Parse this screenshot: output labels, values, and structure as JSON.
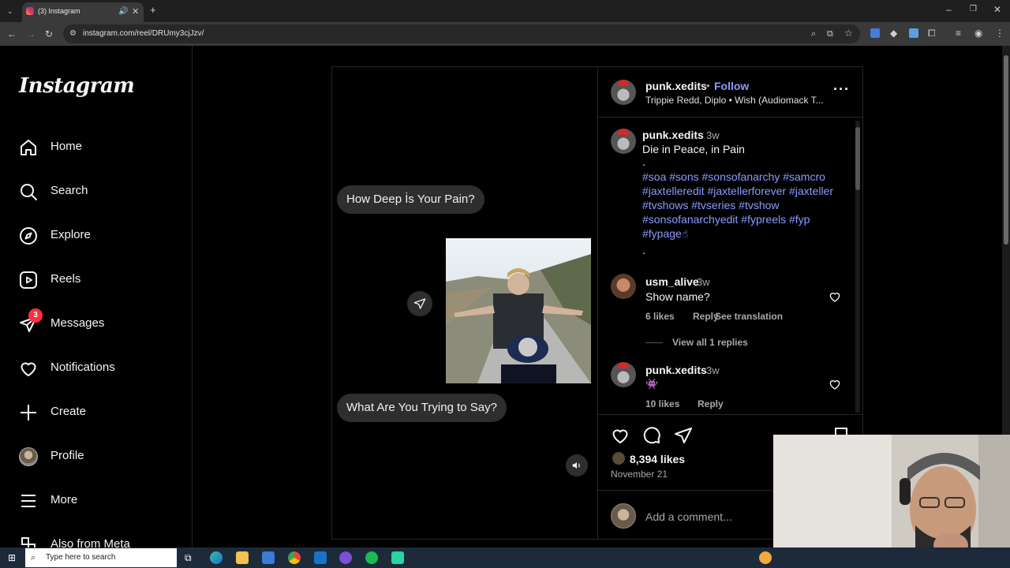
{
  "browser": {
    "tab_title": "(3) Instagram",
    "url": "instagram.com/reel/DRUmy3cjJzv/"
  },
  "sidebar": {
    "logo": "Instagram",
    "items": [
      {
        "label": "Home",
        "icon": "home-icon"
      },
      {
        "label": "Search",
        "icon": "search-icon"
      },
      {
        "label": "Explore",
        "icon": "explore-icon"
      },
      {
        "label": "Reels",
        "icon": "reels-icon"
      },
      {
        "label": "Messages",
        "icon": "messages-icon",
        "badge": "3"
      },
      {
        "label": "Notifications",
        "icon": "heart-icon"
      },
      {
        "label": "Create",
        "icon": "plus-icon"
      },
      {
        "label": "Profile",
        "icon": "avatar"
      },
      {
        "label": "More",
        "icon": "menu-icon"
      },
      {
        "label": "Also from Meta",
        "icon": "meta-icon"
      }
    ]
  },
  "reel": {
    "bubble_top": "How Deep İs Your Pain?",
    "bubble_bottom": "What Are You Trying to Say?"
  },
  "post": {
    "author": "punk.xedits",
    "follow": "Follow",
    "dot": "•",
    "audio": "Trippie Redd, Diplo • Wish (Audiomack T...",
    "caption_author": "punk.xedits",
    "caption_time": "3w",
    "caption": "Die in Peace, in Pain",
    "caption_dot": ".",
    "hashtags": "#soa #sons #sonsofanarchy #samcro #jaxtelleredit #jaxtellerforever #jaxteller #tvshows #tvseries #tvshow #sonsofanarchyedit #fypreels #fyp #fypage☝",
    "caption_dot2": ".",
    "likes": "8,394 likes",
    "date": "November 21",
    "add_comment": "Add a comment..."
  },
  "comments": [
    {
      "user": "usm_alive",
      "time": "3w",
      "text": "Show name?",
      "likes": "6 likes",
      "reply": "Reply",
      "translate": "See translation",
      "view_replies": "View all 1 replies"
    },
    {
      "user": "punk.xedits",
      "time": "3w",
      "text": "👾",
      "likes": "10 likes",
      "reply": "Reply"
    }
  ],
  "taskbar": {
    "search_placeholder": "Type here to search"
  },
  "colors": {
    "link_blue": "#8c9bff",
    "badge_red": "#ff3040",
    "taskbar": "#1c2a3a"
  }
}
